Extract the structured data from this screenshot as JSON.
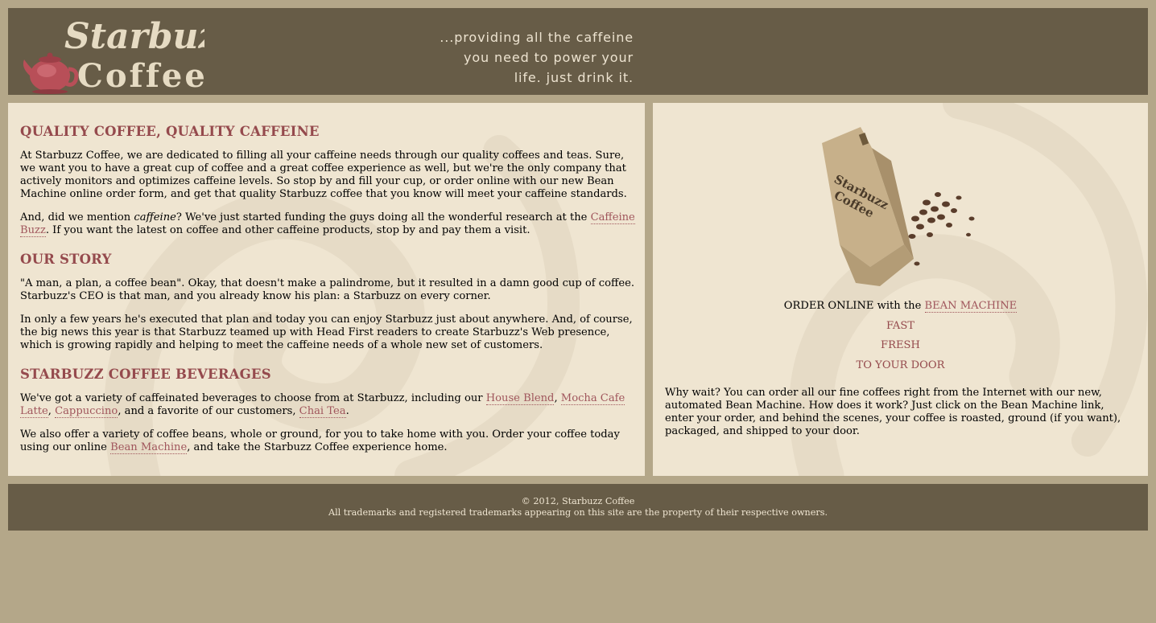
{
  "header": {
    "logo_line1": "Starbuzz",
    "logo_line2": "Coffee",
    "tagline": [
      "...providing all the caffeine",
      "you need to power your",
      "life. just drink it."
    ]
  },
  "main": {
    "h1": "QUALITY COFFEE, QUALITY CAFFEINE",
    "p1": "At Starbuzz Coffee, we are dedicated to filling all your caffeine needs through our quality coffees and teas. Sure, we want you to have a great cup of coffee and a great coffee experience as well, but we're the only company that actively monitors and optimizes caffeine levels. So stop by and fill your cup, or order online with our new Bean Machine online order form, and get that quality Starbuzz coffee that you know will meet your caffeine standards.",
    "p2_a": "And, did we mention ",
    "p2_em": "caffeine",
    "p2_b": "? We've just started funding the guys doing all the wonderful research at the ",
    "p2_link": "Caffeine Buzz",
    "p2_c": ". If you want the latest on coffee and other caffeine products, stop by and pay them a visit.",
    "h2": "OUR STORY",
    "p3": "\"A man, a plan, a coffee bean\". Okay, that doesn't make a palindrome, but it resulted in a damn good cup of coffee. Starbuzz's CEO is that man, and you already know his plan: a Starbuzz on every corner.",
    "p4": "In only a few years he's executed that plan and today you can enjoy Starbuzz just about anywhere. And, of course, the big news this year is that Starbuzz teamed up with Head First readers to create Starbuzz's Web presence, which is growing rapidly and helping to meet the caffeine needs of a whole new set of customers.",
    "h3": "STARBUZZ COFFEE BEVERAGES",
    "p5_a": "We've got a variety of caffeinated beverages to choose from at Starbuzz, including our ",
    "p5_link1": "House Blend",
    "p5_sep1": ", ",
    "p5_link2": "Mocha Cafe Latte",
    "p5_sep2": ", ",
    "p5_link3": "Cappuccino",
    "p5_b": ", and a favorite of our customers, ",
    "p5_link4": "Chai Tea",
    "p5_c": ".",
    "p6_a": "We also offer a variety of coffee beans, whole or ground, for you to take home with you. Order your coffee today using our online ",
    "p6_link": "Bean Machine",
    "p6_b": ", and take the Starbuzz Coffee experience home."
  },
  "sidebar": {
    "bag_text_1": "Starbuzz",
    "bag_text_2": "Coffee",
    "order_prefix": "ORDER ONLINE with the ",
    "order_link": "BEAN MACHINE",
    "fast": "FAST",
    "fresh": "FRESH",
    "door": "TO YOUR DOOR",
    "para": "Why wait? You can order all our fine coffees right from the Internet with our new, automated Bean Machine. How does it work? Just click on the Bean Machine link, enter your order, and behind the scenes, your coffee is roasted, ground (if you want), packaged, and shipped to your door."
  },
  "footer": {
    "copyright": "© 2012, Starbuzz Coffee",
    "trademarks": "All trademarks and registered trademarks appearing on this site are the property of their respective owners."
  },
  "colors": {
    "page_bg": "#b4a789",
    "header_bg": "#675c47",
    "panel_bg": "#efe5d1",
    "heading": "#954a4d",
    "link": "#a0565c"
  }
}
